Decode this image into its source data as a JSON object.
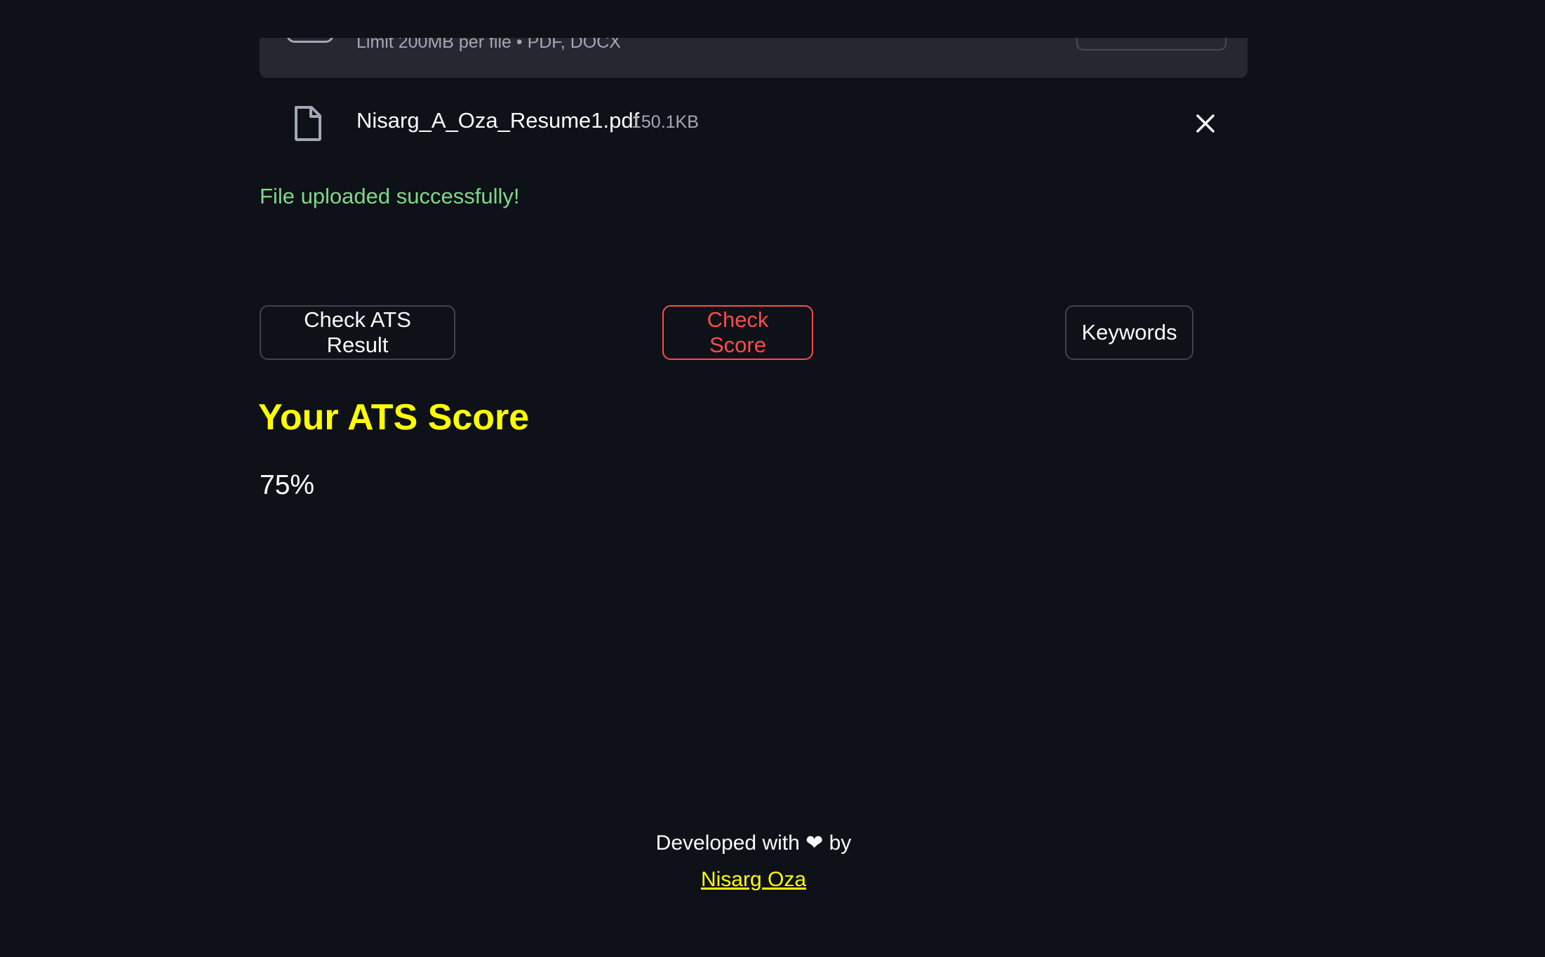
{
  "uploader": {
    "limit_text": "Limit 200MB per file • PDF, DOCX"
  },
  "file": {
    "name": "Nisarg_A_Oza_Resume1.pdf",
    "size": "150.1KB",
    "icon": "file-icon",
    "remove_icon": "close-icon"
  },
  "status": {
    "success_message": "File uploaded successfully!",
    "success_color": "#7fd88a"
  },
  "actions": {
    "check_ats_label": "Check ATS Result",
    "check_score_label": "Check Score",
    "keywords_label": "Keywords",
    "active_color": "#ff4b4b"
  },
  "result": {
    "heading": "Your ATS Score",
    "score": "75%",
    "heading_color": "#ffff00"
  },
  "footer": {
    "developed_prefix": "Developed with",
    "heart": "❤",
    "developed_suffix": "by",
    "author_link": "Nisarg Oza"
  },
  "theme": {
    "background": "#0e1117",
    "panel": "#262730"
  }
}
